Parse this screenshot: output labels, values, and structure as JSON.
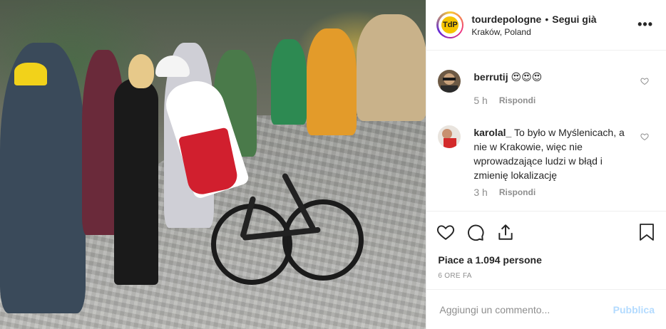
{
  "header": {
    "username": "tourdepologne",
    "separator": "•",
    "follow_label": "Segui già",
    "location": "Kraków, Poland",
    "avatar_text": "TdP",
    "more_label": "•••"
  },
  "comments": [
    {
      "user": "berrutij",
      "text": "😍😍😍",
      "time": "5 h",
      "reply_label": "Rispondi"
    },
    {
      "user": "karolal_",
      "text": "To było w Myślenicach, a nie w Krakowie, więc nie wprowadzające ludzi w błąd i zmienię lokalizację",
      "time": "3 h",
      "reply_label": "Rispondi"
    }
  ],
  "actions": {
    "like_icon": "heart-icon",
    "comment_icon": "comment-icon",
    "share_icon": "share-icon",
    "save_icon": "bookmark-icon"
  },
  "likes_text": "Piace a 1.094 persone",
  "posted_ago": "6 ORE FA",
  "add_comment": {
    "placeholder": "Aggiungi un commento...",
    "publish_label": "Pubblica"
  },
  "colors": {
    "publish_disabled": "#b3dbff",
    "meta_gray": "#8e8e8e",
    "text": "#262626",
    "divider": "#efefef"
  }
}
